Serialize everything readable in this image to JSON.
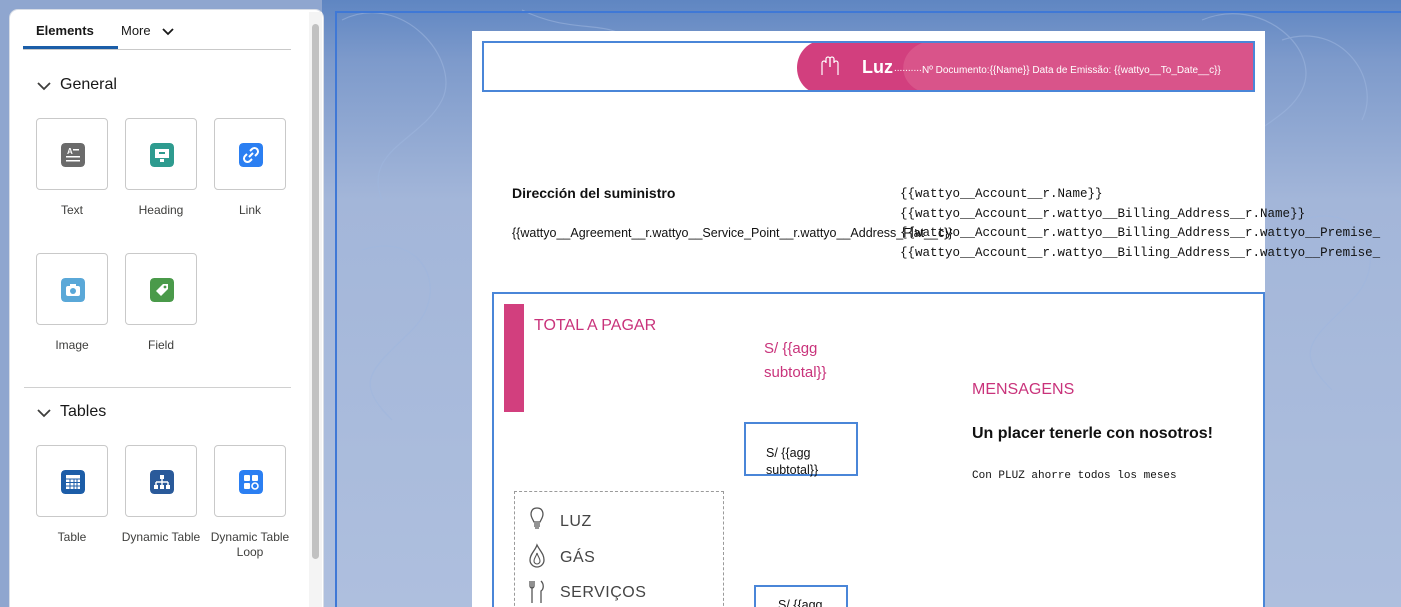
{
  "panel": {
    "tabs": {
      "elements": "Elements",
      "more": "More"
    },
    "sections": [
      {
        "title": "General",
        "items": [
          {
            "label": "Text",
            "icon": "text-icon",
            "color": "#6b6b6b"
          },
          {
            "label": "Heading",
            "icon": "heading-icon",
            "color": "#2e9b8f"
          },
          {
            "label": "Link",
            "icon": "link-icon",
            "color": "#2b7ff2"
          },
          {
            "label": "Image",
            "icon": "image-icon",
            "color": "#5aa8d8"
          },
          {
            "label": "Field",
            "icon": "field-icon",
            "color": "#4a9a4a"
          }
        ]
      },
      {
        "title": "Tables",
        "items": [
          {
            "label": "Table",
            "icon": "table-icon",
            "color": "#1c5da8"
          },
          {
            "label": "Dynamic Table",
            "icon": "dynamic-table-icon",
            "color": "#2a5a9a"
          },
          {
            "label": "Dynamic Table Loop",
            "icon": "dynamic-table-loop-icon",
            "color": "#2b7ff2"
          }
        ]
      }
    ]
  },
  "document": {
    "banner": {
      "title": "Luz",
      "dots": "..........",
      "doc_info": "Nº Documento:{{Name}} Data de Emissão: {{wattyo__To_Date__c}}",
      "color": "#d23f7e"
    },
    "supply_address_label": "Dirección del suministro",
    "service_point_address": "{{wattyo__Agreement__r.wattyo__Service_Point__r.wattyo__Address_Flat__c}}",
    "account_lines": [
      "{{wattyo__Account__r.Name}}",
      "{{wattyo__Account__r.wattyo__Billing_Address__r.Name}}",
      "{{wattyo__Account__r.wattyo__Billing_Address__r.wattyo__Premise_",
      "{{wattyo__Account__r.wattyo__Billing_Address__r.wattyo__Premise_"
    ],
    "total_label": "TOTAL A PAGAR",
    "total_amount_line1": "S/ {{agg",
    "total_amount_line2": "subtotal}}",
    "box1_line1": "S/ {{agg",
    "box1_line2": "subtotal}}",
    "box2_line1": "S/ {{agg",
    "messages_title": "MENSAGENS",
    "messages_headline": "Un placer tenerle con nosotros!",
    "messages_body": "Con PLUZ ahorre todos los meses",
    "services": [
      {
        "label": "LUZ",
        "icon": "lightbulb-icon"
      },
      {
        "label": "GÁS",
        "icon": "flame-icon"
      },
      {
        "label": "SERVIÇOS",
        "icon": "tools-icon"
      }
    ],
    "accent_color": "#c9337b"
  }
}
